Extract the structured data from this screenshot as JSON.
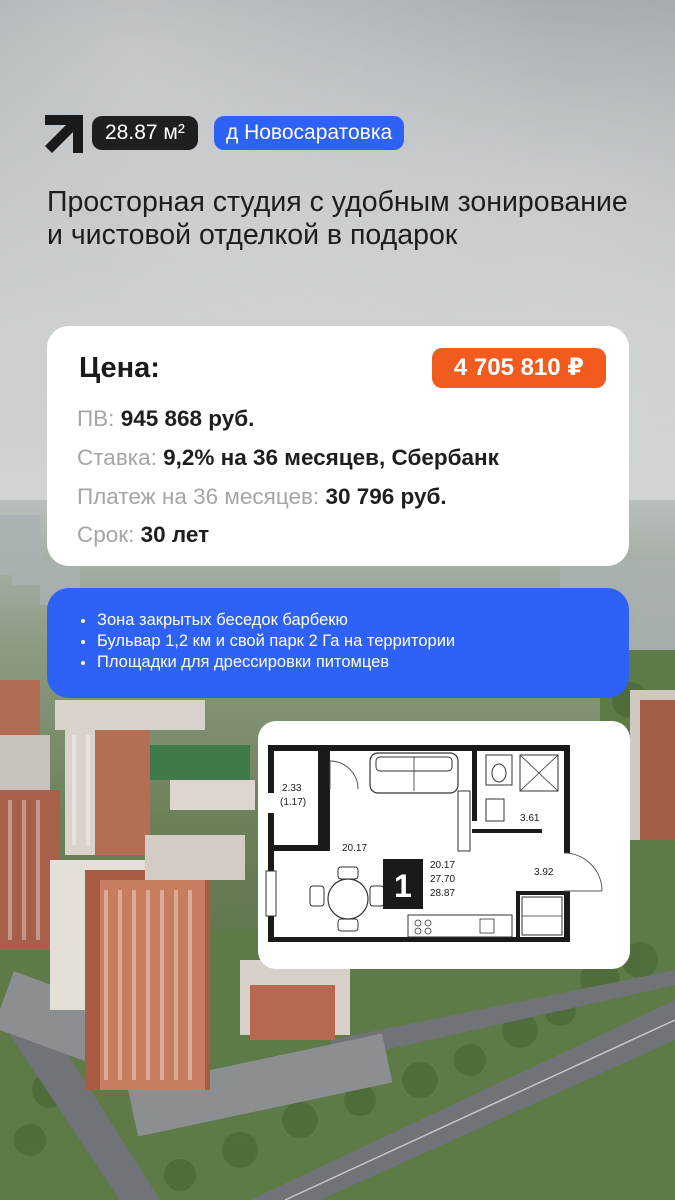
{
  "header": {
    "area": "28.87 м²",
    "location": "д Новосаратовка"
  },
  "title": "Просторная студия с удобным зонирование и чистовой отделкой в подарок",
  "price_card": {
    "label": "Цена:",
    "price": "4 705 810 ₽",
    "rows": [
      {
        "key": "ПВ:",
        "value": "945 868 руб."
      },
      {
        "key": "Ставка:",
        "value": "9,2% на 36 месяцев, Сбербанк"
      },
      {
        "key": "Платеж на 36 месяцев:",
        "value": "30 796 руб."
      },
      {
        "key": "Срок:",
        "value": "30 лет"
      }
    ]
  },
  "features": [
    "Зона закрытых беседок барбекю",
    "Бульвар 1,2 км и свой парк 2 Га на территории",
    "Площадки для дрессировки питомцев"
  ],
  "floor_plan": {
    "rooms_count": "1",
    "areas": [
      "20.17",
      "27.70",
      "28.87"
    ],
    "room_labels": {
      "balcony": "2.33",
      "balcony_sub": "(1.17)",
      "living": "20.17",
      "bath": "3.61",
      "hall": "3.92"
    }
  },
  "colors": {
    "accent_blue": "#2e61f5",
    "accent_orange": "#f25b1e",
    "dark_badge": "#1e1f22"
  }
}
